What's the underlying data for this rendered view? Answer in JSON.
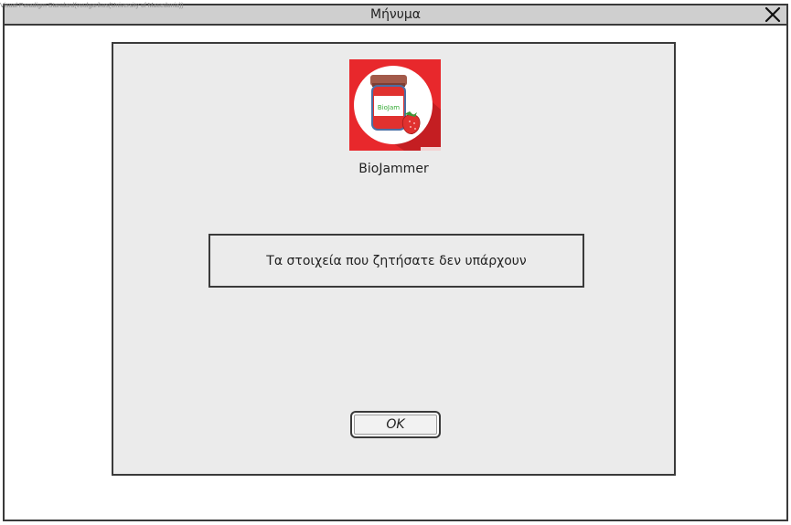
{
  "watermark": "Visual Paradigm Standard(voulgarikos(University of Macedonia))",
  "window": {
    "title": "Μήνυμα",
    "close_icon": "close-x-icon"
  },
  "dialog": {
    "logo_icon": "biojam-jar-logo",
    "logo_label": "BioJam",
    "app_name": "BioJammer",
    "message": "Τα στοιχεία που ζητήσατε δεν υπάρχουν",
    "ok_label": "OK"
  },
  "colors": {
    "logo_background": "#e8282c",
    "panel_background": "#ebebeb",
    "titlebar_background": "#cfcfcf"
  }
}
